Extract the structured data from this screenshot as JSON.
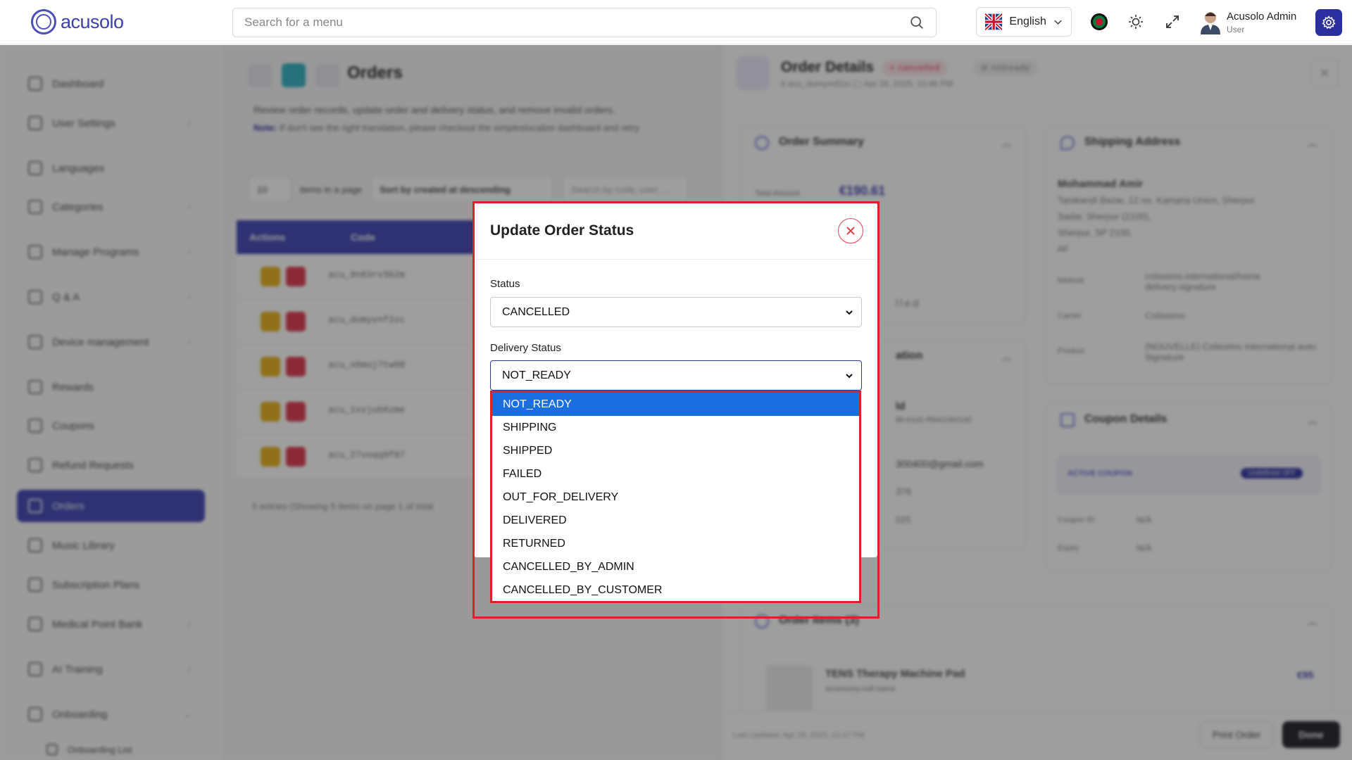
{
  "topbar": {
    "logo_text": "acusolo",
    "search_placeholder": "Search for a menu",
    "language": "English",
    "user_name": "Acusolo Admin",
    "user_role": "User"
  },
  "sidebar": {
    "items": [
      {
        "label": "Dashboard",
        "has_children": false
      },
      {
        "label": "User Settings",
        "has_children": true
      },
      {
        "label": "Languages",
        "has_children": false
      },
      {
        "label": "Categories",
        "has_children": true
      },
      {
        "label": "Manage Programs",
        "has_children": true
      },
      {
        "label": "Q & A",
        "has_children": true
      },
      {
        "label": "Device management",
        "has_children": true
      },
      {
        "label": "Rewards",
        "has_children": false
      },
      {
        "label": "Coupons",
        "has_children": false
      },
      {
        "label": "Refund Requests",
        "has_children": false
      },
      {
        "label": "Orders",
        "has_children": false,
        "active": true
      },
      {
        "label": "Music Library",
        "has_children": false
      },
      {
        "label": "Subscription Plans",
        "has_children": false
      },
      {
        "label": "Medical Point Bank",
        "has_children": true
      },
      {
        "label": "AI Training",
        "has_children": true
      },
      {
        "label": "Onboarding",
        "has_children": true
      },
      {
        "label": "Onboarding List",
        "has_children": false
      }
    ]
  },
  "page": {
    "title": "Orders",
    "description": "Review order records, update order and delivery status, and remove invalid orders.",
    "note_label": "Note:",
    "note_text": "If don't see the right translation, please checkout the simpleslocalize dashboard and retry",
    "page_size": "10",
    "items_label": "items in a page",
    "sort_label": "Sort by created at descending",
    "search_placeholder": "Search by code, user, ...",
    "columns": [
      "Actions",
      "Code"
    ],
    "rows": [
      {
        "code": "acu_8n83rv3b2m"
      },
      {
        "code": "acu_domyvnf2zc"
      },
      {
        "code": "acu_n8muj7tw08"
      },
      {
        "code": "acu_1xvjub6zme"
      },
      {
        "code": "acu_27voqq9f87"
      }
    ],
    "footer": "5 entries (Showing 5 items on page 1 of total"
  },
  "drawer": {
    "title": "Order Details",
    "badge_status": "× cancelled",
    "badge_delivery": "⊘ notready",
    "meta": "# acu_domyvnf2zc   ▢ Apr 28, 2025, 10:46 PM",
    "order_summary": {
      "title": "Order Summary",
      "total_label": "Total Amount",
      "total_value": "€190.61",
      "status_partial": "lled"
    },
    "shipping": {
      "title": "Shipping Address",
      "name": "Mohammad Amir",
      "address1": "Tarakandi Bazar, 12 no. Kamaria Union, Sherpur",
      "address2": "Sadar, Sherpur (2100),",
      "address3": "Sherpur, SP 2100,",
      "address4": "AF",
      "method_label": "Method",
      "method_value": "colissimo.international/home delivery.signature",
      "carrier_label": "Carrier",
      "carrier_value": "Colissimo",
      "product_label": "Product",
      "product_value": "(NOUVELLE) Colissimo International avec Signature"
    },
    "customer_partial": {
      "title_partial": "ation",
      "id_partial": "ld",
      "uuid_partial": "86-b1d1-f5b410b01d2",
      "email_partial": "300400@gmail.com",
      "phone_partial": "378",
      "date_partial": "025"
    },
    "coupon": {
      "title": "Coupon Details",
      "active_label": "ACTIVE COUPON",
      "active_value": "Undefined OFF",
      "id_label": "Coupon ID",
      "id_value": "N/A",
      "expiry_label": "Expiry",
      "expiry_value": "N/A"
    },
    "items": {
      "title": "Order Items (3)",
      "item_name": "TENS Therapy Machine Pad",
      "item_sub": "accessory.null.name",
      "item_price": "€95"
    },
    "footer": {
      "last_updated": "Last Updated: Apr 28, 2025, 10:47 PM",
      "print": "Print Order",
      "done": "Done"
    }
  },
  "modal": {
    "title": "Update Order Status",
    "status_label": "Status",
    "status_value": "CANCELLED",
    "delivery_label": "Delivery Status",
    "delivery_value": "NOT_READY",
    "delivery_options": [
      "NOT_READY",
      "SHIPPING",
      "SHIPPED",
      "FAILED",
      "OUT_FOR_DELIVERY",
      "DELIVERED",
      "RETURNED",
      "CANCELLED_BY_ADMIN",
      "CANCELLED_BY_CUSTOMER"
    ],
    "selected_index": 0
  },
  "colors": {
    "brand": "#4b4fb8",
    "accent_dark": "#2b2fa0",
    "highlight": "#d8232a",
    "option_selected": "#1a6fe0",
    "edit": "#e8b52a",
    "delete": "#e0445a"
  }
}
